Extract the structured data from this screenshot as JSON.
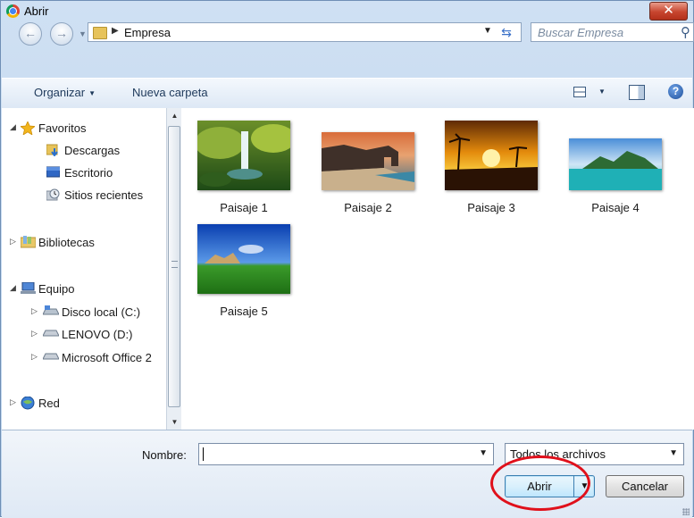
{
  "window": {
    "title": "Abrir",
    "close_glyph": "✕"
  },
  "address": {
    "back_glyph": "←",
    "forward_glyph": "→",
    "crumb_arrow": "▶",
    "location": "Empresa",
    "refresh_glyph": "⇆",
    "dropdown_glyph": "▼"
  },
  "search": {
    "placeholder": "Buscar Empresa",
    "icon_glyph": "⚲"
  },
  "toolbar": {
    "organize_label": "Organizar",
    "new_folder_label": "Nueva carpeta",
    "help_glyph": "?"
  },
  "nav": {
    "items": [
      {
        "label": "Favoritos",
        "expander": "◢",
        "icon": "star-icon"
      },
      {
        "label": "Descargas",
        "icon": "downloads-folder-icon"
      },
      {
        "label": "Escritorio",
        "icon": "desktop-icon"
      },
      {
        "label": "Sitios recientes",
        "icon": "recent-places-icon"
      },
      {
        "label": "Bibliotecas",
        "expander": "▷",
        "icon": "libraries-icon"
      },
      {
        "label": "Equipo",
        "expander": "◢",
        "icon": "computer-icon"
      },
      {
        "label": "Disco local (C:)",
        "expander": "▷",
        "icon": "local-disk-icon"
      },
      {
        "label": "LENOVO (D:)",
        "expander": "▷",
        "icon": "drive-icon"
      },
      {
        "label": "Microsoft Office 2",
        "expander": "▷",
        "icon": "drive-icon"
      },
      {
        "label": "Red",
        "expander": "▷",
        "icon": "network-icon"
      }
    ]
  },
  "files": [
    {
      "name": "Paisaje 1",
      "icon": "waterfall-landscape-thumbnail"
    },
    {
      "name": "Paisaje 2",
      "icon": "beach-arch-landscape-thumbnail"
    },
    {
      "name": "Paisaje 3",
      "icon": "sunset-landscape-thumbnail"
    },
    {
      "name": "Paisaje 4",
      "icon": "tropical-island-landscape-thumbnail"
    },
    {
      "name": "Paisaje 5",
      "icon": "green-field-landscape-thumbnail"
    }
  ],
  "footer": {
    "name_label": "Nombre:",
    "name_value": "",
    "filter_value": "Todos los archivos",
    "open_label": "Abrir",
    "cancel_label": "Cancelar"
  },
  "annotation": {
    "color": "#e0101b"
  }
}
